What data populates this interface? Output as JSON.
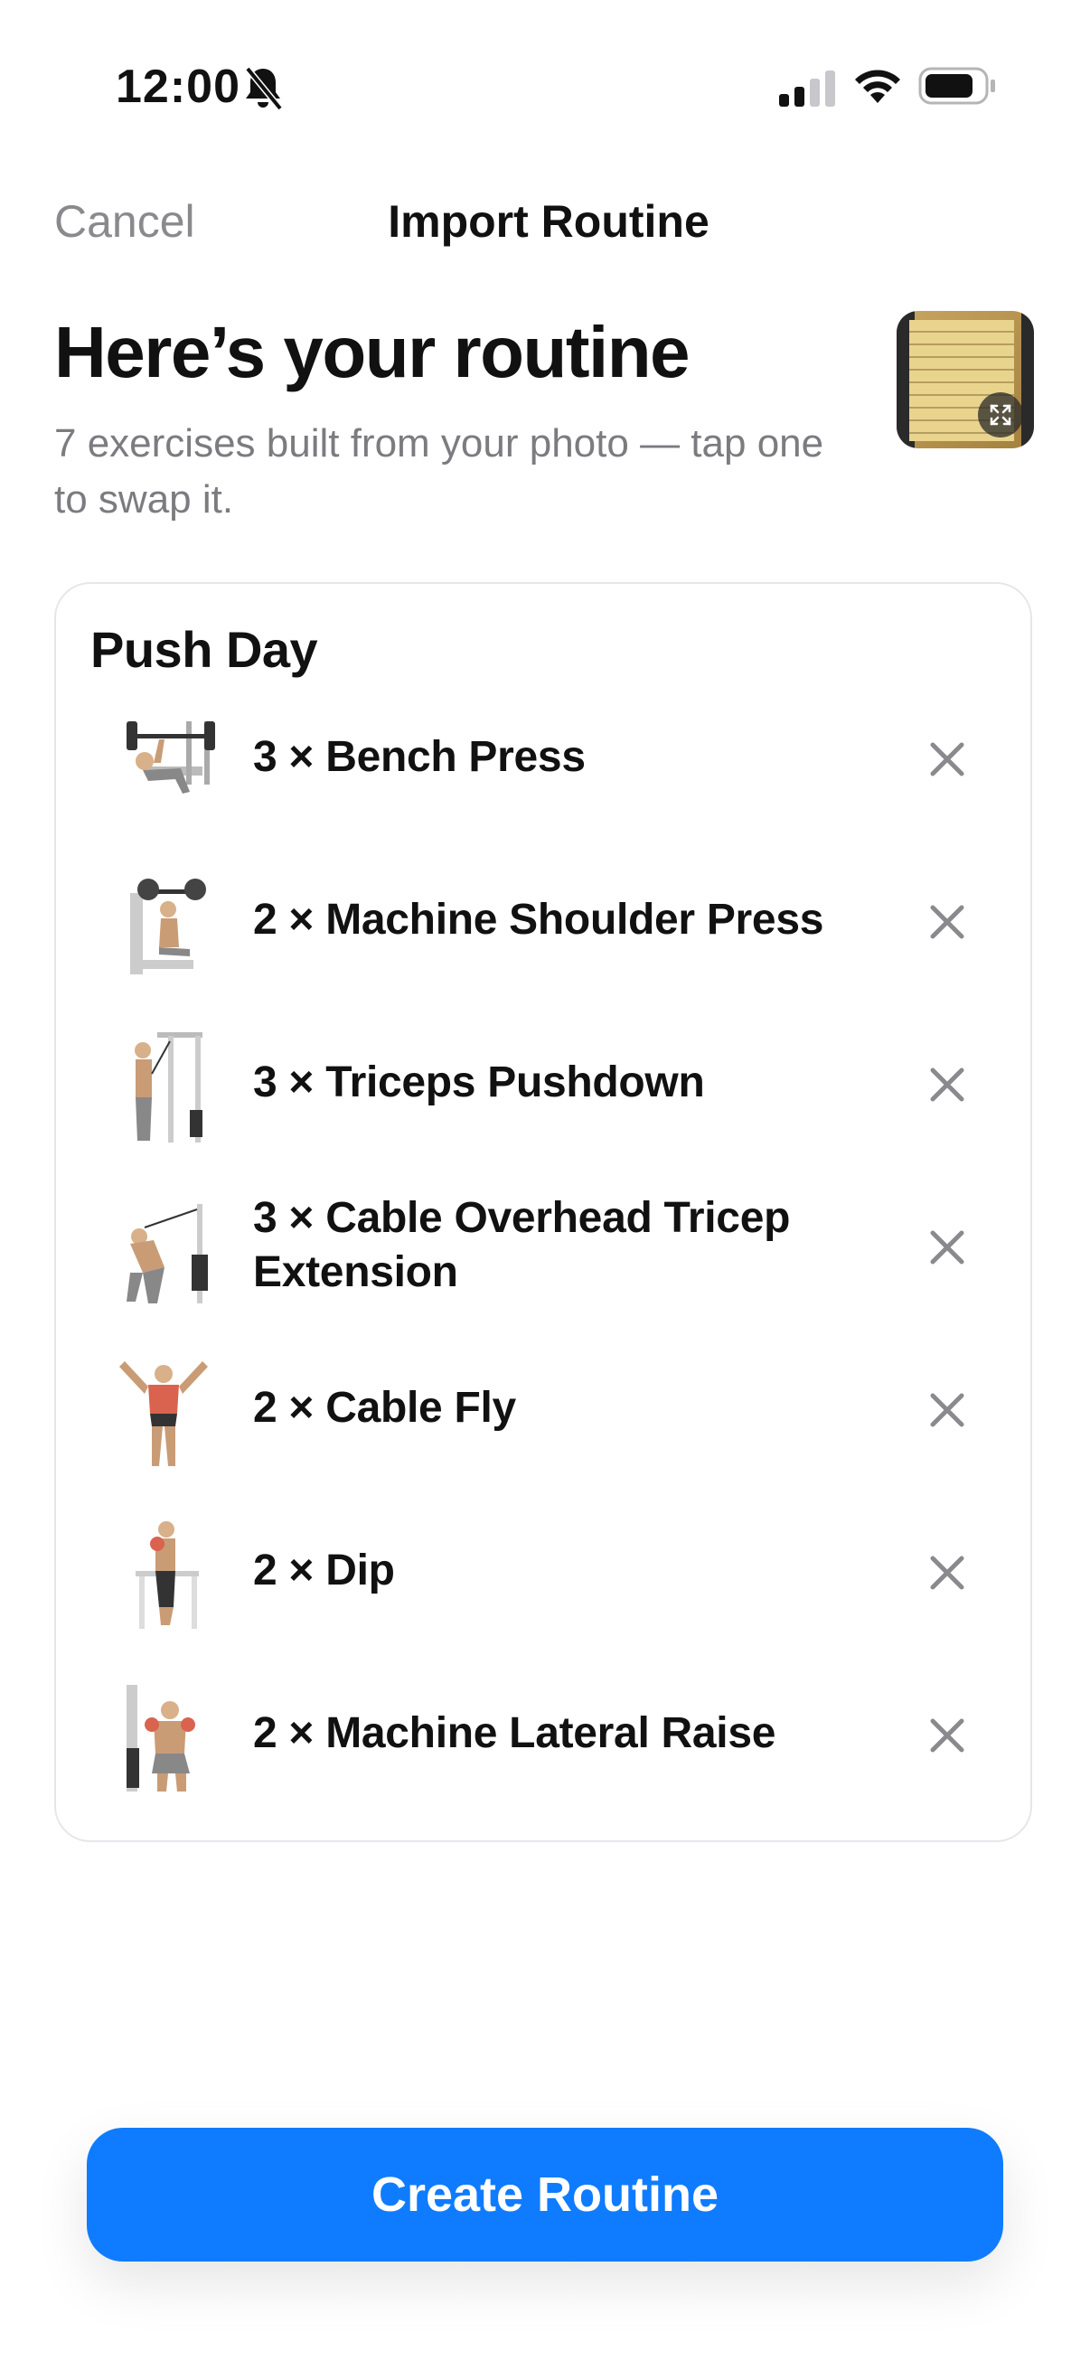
{
  "status_bar": {
    "time": "12:00"
  },
  "nav": {
    "cancel_label": "Cancel",
    "title": "Import Routine"
  },
  "header": {
    "headline": "Here’s your routine",
    "subtitle": "7 exercises built from your photo — tap one to swap it."
  },
  "routine": {
    "name": "Push Day",
    "exercises": [
      {
        "label": "3 × Bench Press"
      },
      {
        "label": "2 × Machine Shoulder Press"
      },
      {
        "label": "3 × Triceps Pushdown"
      },
      {
        "label": "3 × Cable Overhead Tricep Extension"
      },
      {
        "label": "2 × Cable Fly"
      },
      {
        "label": "2 × Dip"
      },
      {
        "label": "2 × Machine Lateral Raise"
      }
    ]
  },
  "cta": {
    "label": "Create Routine"
  },
  "colors": {
    "accent": "#0F7CFF",
    "secondary_text": "#8A8A8E",
    "card_border": "#E6E6EA"
  }
}
